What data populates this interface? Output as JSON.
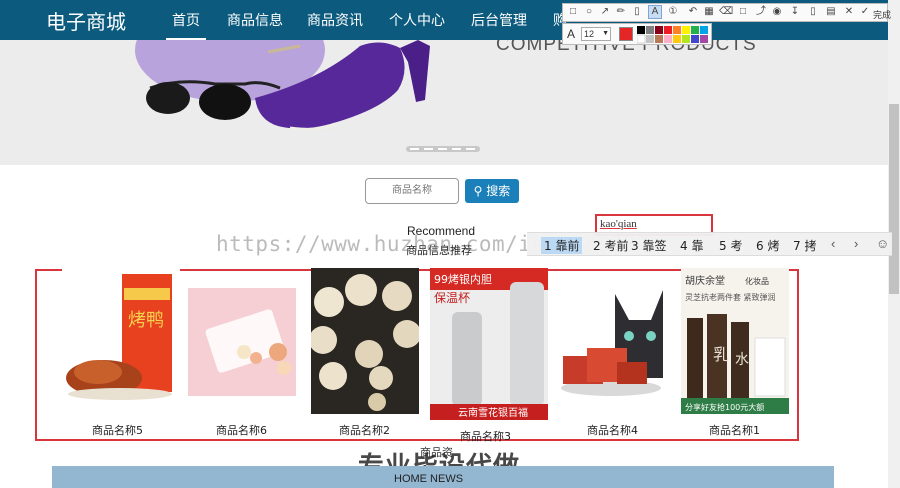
{
  "nav": {
    "brand": "电子商城",
    "items": [
      "首页",
      "商品信息",
      "商品资讯",
      "个人中心",
      "后台管理",
      "购"
    ]
  },
  "banner": {
    "title": "COMPETITIVE PRODUCTS"
  },
  "search": {
    "placeholder": "商品名称",
    "button_label": "搜索"
  },
  "recommend": {
    "title_en": "Recommend",
    "title_cn": "商品信息推荐"
  },
  "ime": {
    "composition": "kao'qian",
    "candidates": [
      "1 靠前",
      "2 考前",
      "3 靠签",
      "4 靠",
      "5 考",
      "6 烤",
      "7 拷"
    ]
  },
  "products": [
    {
      "name": "商品名称5"
    },
    {
      "name": "商品名称6"
    },
    {
      "name": "商品名称2"
    },
    {
      "name": "商品名称3"
    },
    {
      "name": "商品名称4"
    },
    {
      "name": "商品名称1"
    }
  ],
  "product_texts": {
    "p1_label": "烤鸭",
    "p4_top": "99烤银内胆",
    "p4_mid": "保温杯",
    "p4_bottom": "云南雪花银百福",
    "p6_brand": "胡庆余堂",
    "p6_tag": "化妆品",
    "p6_sub": "灵芝抗老两件套 紧致弹润",
    "p6_bottom": "分享好友抢100元大额",
    "p6_glyph1": "乳",
    "p6_glyph2": "水"
  },
  "partial_label": "商品资",
  "watermark": {
    "url": "https://www.huzhan.com/ishop89387",
    "text": "专业毕设代做"
  },
  "news": {
    "title": "HOME NEWS"
  },
  "toolbar": {
    "finish": "完成",
    "font_size": "12"
  },
  "colors": {
    "nav_bg": "#0c5b7e",
    "accent": "#1b7fb9",
    "frame_red": "#d8363c",
    "news_band": "#93b6d1"
  }
}
